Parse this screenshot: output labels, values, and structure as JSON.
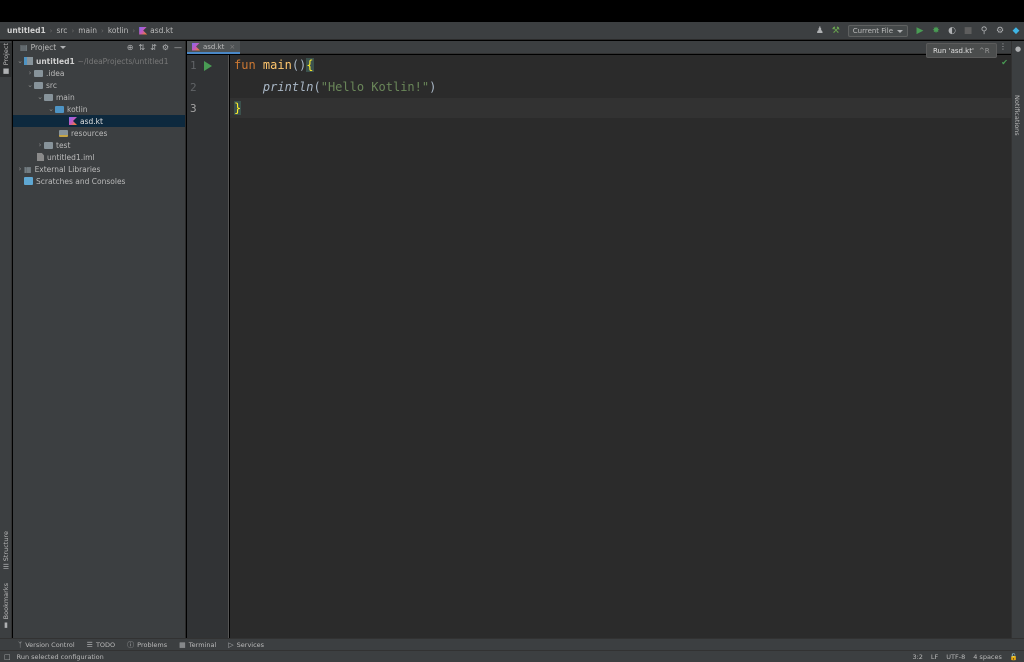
{
  "breadcrumb": {
    "project": "untitled1",
    "items": [
      "src",
      "main",
      "kotlin"
    ],
    "file": "asd.kt"
  },
  "toolbar": {
    "run_config": "Current File",
    "icons": [
      "user-icon",
      "build-hammer-icon",
      "run-icon",
      "debug-icon",
      "coverage-icon",
      "stop-icon",
      "search-icon",
      "gear-icon",
      "jetbrains-icon"
    ]
  },
  "tooltip": {
    "text": "Run 'asd.kt'",
    "shortcut": "^R"
  },
  "left_stripe": {
    "project": "Project",
    "structure": "Structure",
    "bookmarks": "Bookmarks"
  },
  "right_stripe": {
    "notifications": "Notifications"
  },
  "project_panel": {
    "title": "Project",
    "tree": {
      "root": "untitled1",
      "root_path": "~/IdeaProjects/untitled1",
      "idea": ".idea",
      "src": "src",
      "main": "main",
      "kotlin": "kotlin",
      "file": "asd.kt",
      "resources": "resources",
      "test": "test",
      "iml": "untitled1.iml",
      "ext_libs": "External Libraries",
      "scratches": "Scratches and Consoles"
    }
  },
  "editor": {
    "tab": "asd.kt",
    "line_numbers": [
      "1",
      "2",
      "3"
    ],
    "code": {
      "kw_fun": "fun",
      "fn_main": "main",
      "parens": "()",
      "open_brace": "{",
      "println": "println",
      "paren_open": "(",
      "string": "\"Hello Kotlin!\"",
      "paren_close": ")",
      "close_brace": "}"
    }
  },
  "bottom_tools": {
    "vcs": "Version Control",
    "todo": "TODO",
    "problems": "Problems",
    "terminal": "Terminal",
    "services": "Services"
  },
  "status": {
    "message": "Run selected configuration",
    "position": "3:2",
    "line_sep": "LF",
    "encoding": "UTF-8",
    "indent": "4 spaces"
  },
  "colors": {
    "keyword": "#cc7832",
    "function": "#ffc66d",
    "string": "#6a8759",
    "run_green": "#499c54",
    "selection": "#0d293e",
    "editor_bg": "#2b2b2b"
  }
}
